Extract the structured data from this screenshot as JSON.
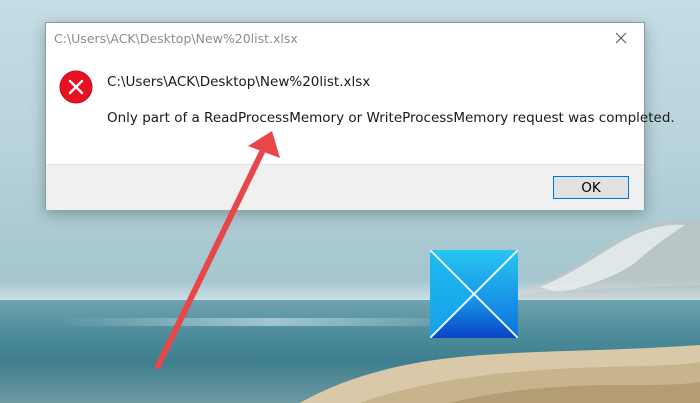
{
  "dialog": {
    "title": "C:\\Users\\ACK\\Desktop\\New%20list.xlsx",
    "close_icon": "close-icon",
    "error_icon": "error-icon",
    "file_path": "C:\\Users\\ACK\\Desktop\\New%20list.xlsx",
    "message": "Only part of a ReadProcessMemory or WriteProcessMemory request was completed.",
    "ok_label": "OK"
  },
  "colors": {
    "error_red": "#e81123",
    "accent": "#0078d7",
    "annotation_arrow": "#e8474a",
    "logo_blue_top": "#1fc3ee",
    "logo_blue_bottom": "#0a4fd6"
  },
  "desktop": {
    "logo_icon": "windows-logo-icon",
    "annotation": "red-arrow-pointer"
  }
}
